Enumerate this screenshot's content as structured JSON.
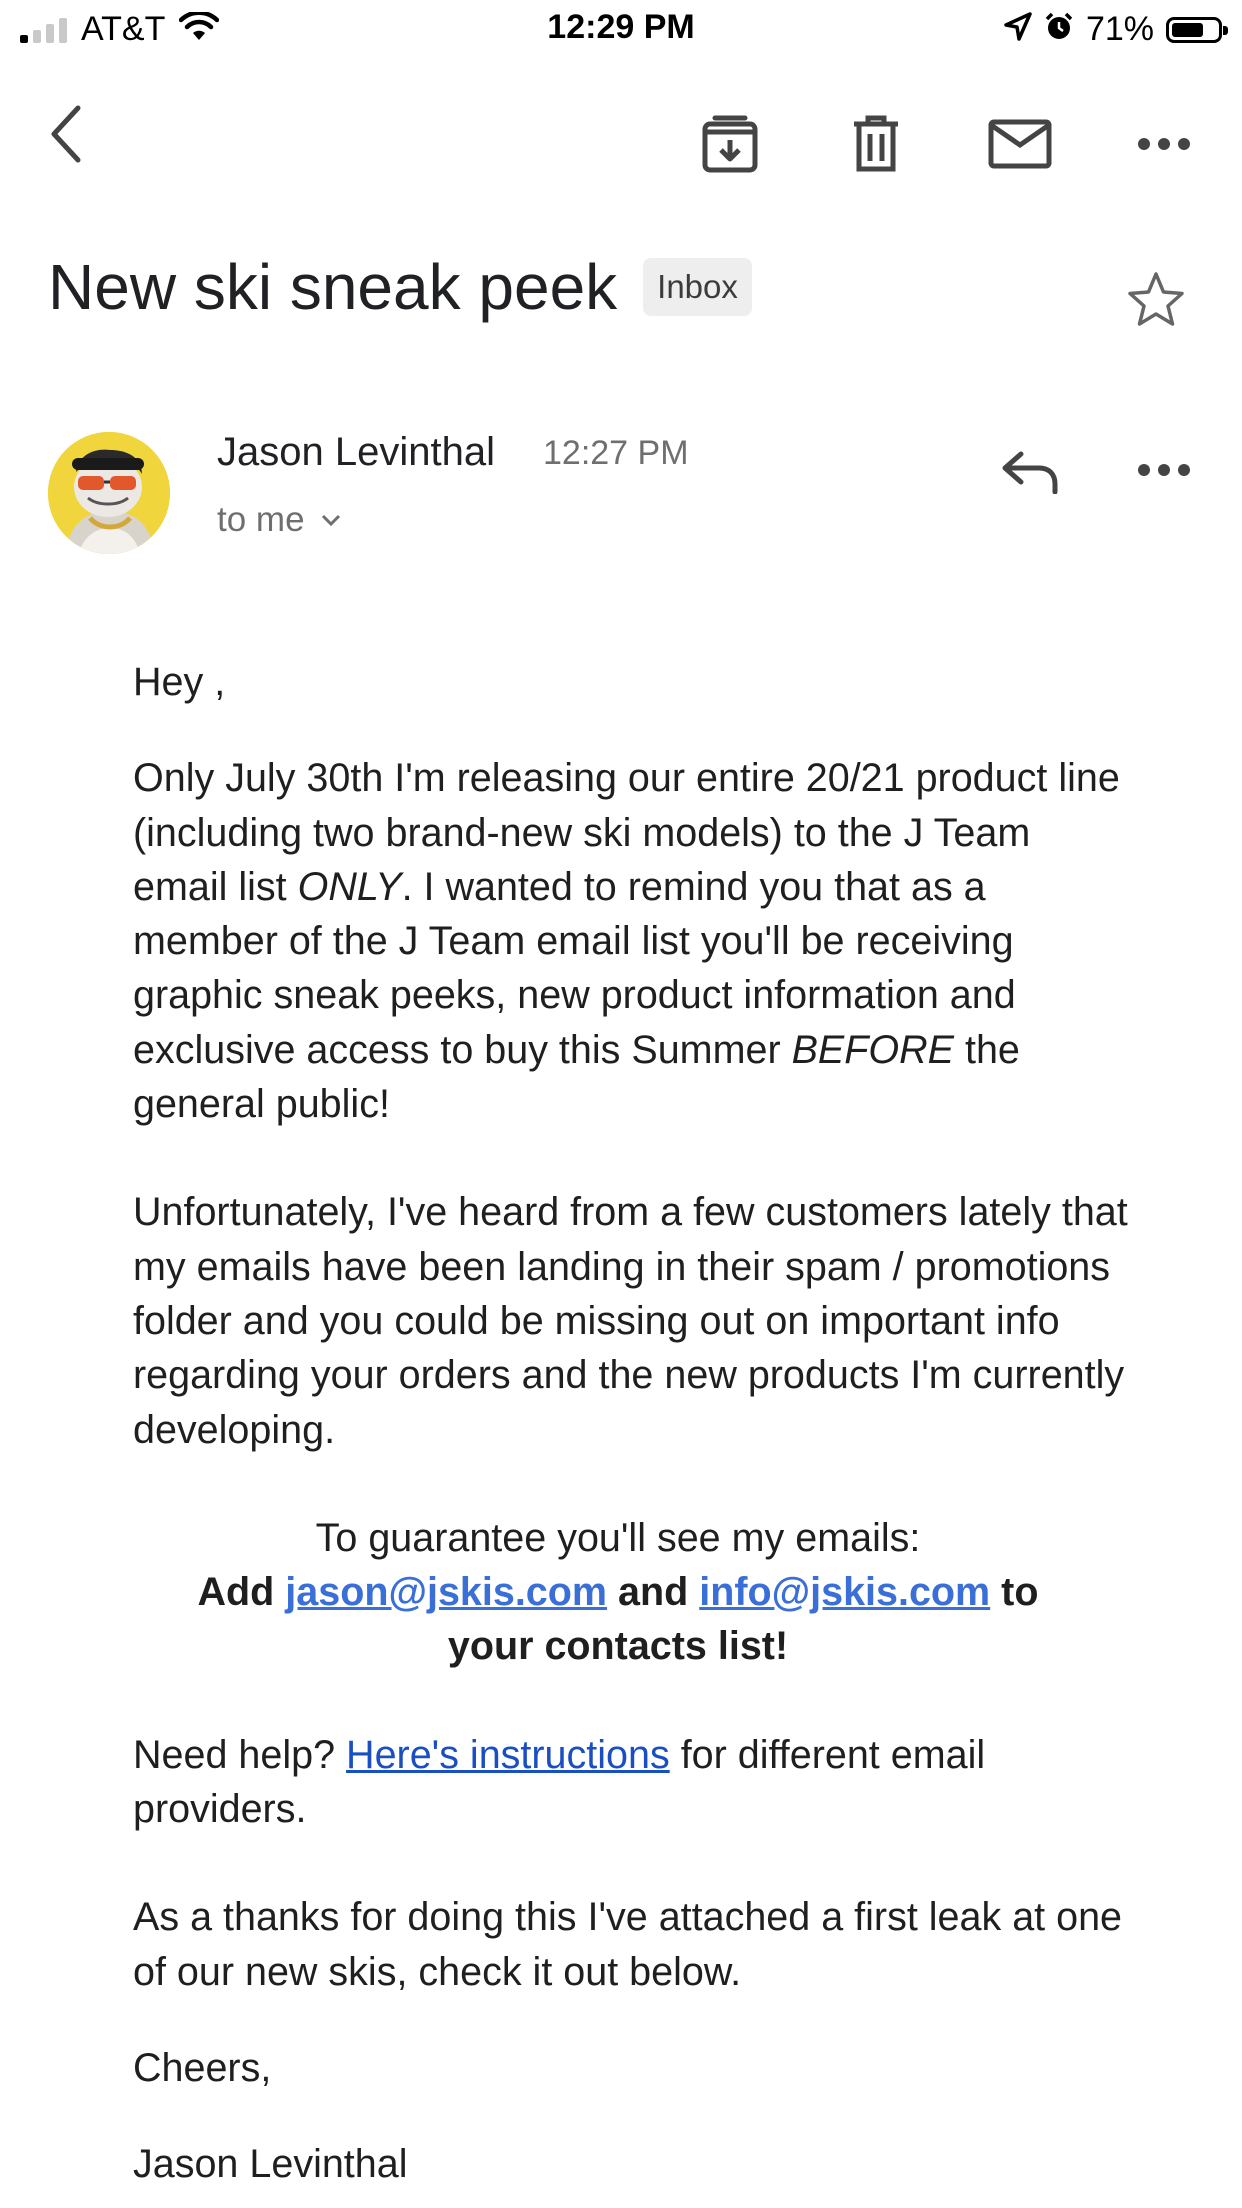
{
  "status_bar": {
    "carrier": "AT&T",
    "time": "12:29 PM",
    "battery_percent": "71%",
    "battery_level": 0.71,
    "signal_bars": 1,
    "icons": [
      "wifi-icon",
      "location-arrow-icon",
      "alarm-icon",
      "battery-icon"
    ]
  },
  "toolbar": {
    "icons": [
      "back-arrow-icon",
      "archive-icon",
      "delete-icon",
      "mark-unread-icon",
      "more-icon"
    ]
  },
  "email": {
    "subject": "New ski sneak peek",
    "label": "Inbox",
    "starred": false,
    "sender": {
      "name": "Jason Levinthal",
      "time": "12:27 PM",
      "recipient": "to me"
    },
    "body": {
      "greeting": "Hey ,",
      "p1_a": "Only July 30th I'm releasing our entire 20/21 product line (including two brand-new ski models) to the J Team email list ",
      "p1_em": "ONLY",
      "p1_b": ". I wanted to remind you that as a member of the J Team email list you'll be receiving graphic sneak peeks, new product information and exclusive access to buy this Summer ",
      "p1_em2": "BEFORE",
      "p1_c": " the general public!",
      "p2": "Unfortunately, I've heard from a few customers lately that my emails have been landing in their spam / promotions folder and you could be missing out on important info regarding your orders and the new products I'm currently developing.",
      "guarantee": "To guarantee you'll see my emails:",
      "add": "Add",
      "email1": "jason@jskis.com",
      "and": "and",
      "email2": "info@jskis.com",
      "to": "to",
      "contacts": "your contacts list!",
      "help_a": "Need help?",
      "help_link": "Here's instructions",
      "help_b": "for different email providers.",
      "thanks": "As a thanks for doing this I've attached a first leak at one of our new skis, check it out below.",
      "signoff": "Cheers,",
      "signature": "Jason Levinthal"
    }
  }
}
